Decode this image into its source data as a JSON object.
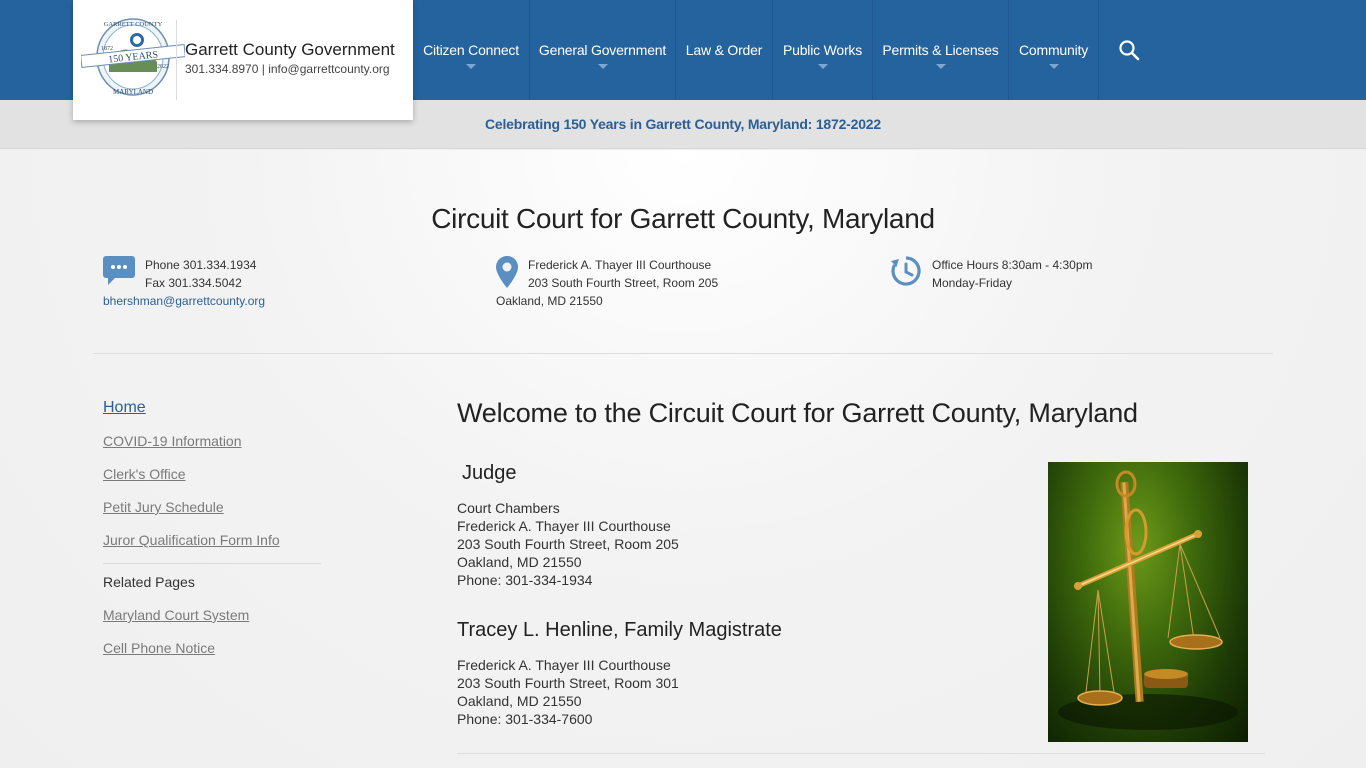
{
  "header": {
    "org_name": "Garrett County Government",
    "org_contact": "301.334.8970 | info@garrettcounty.org",
    "seal_text_top": "GARRETT COUNTY",
    "seal_text_years": "150 YEARS",
    "seal_year_left": "1872",
    "seal_year_right": "2022",
    "seal_text_bottom": "MARYLAND",
    "brand_color": "#25639f"
  },
  "nav": {
    "items": [
      {
        "label": "Citizen Connect",
        "has_dropdown": true
      },
      {
        "label": "General Government",
        "has_dropdown": true
      },
      {
        "label": "Law & Order",
        "has_dropdown": false
      },
      {
        "label": "Public Works",
        "has_dropdown": true
      },
      {
        "label": "Permits & Licenses",
        "has_dropdown": true
      },
      {
        "label": "Community",
        "has_dropdown": true
      }
    ],
    "search_icon": "search-icon"
  },
  "banner": {
    "text": "Celebrating 150 Years in Garrett County, Maryland: 1872-2022"
  },
  "court": {
    "title": "Circuit Court for Garrett County, Maryland",
    "contact": {
      "phone": "Phone 301.334.1934",
      "fax": "Fax 301.334.5042",
      "email": "bhershman@garrettcounty.org"
    },
    "location": {
      "building": "Frederick A. Thayer III Courthouse",
      "street": "203 South Fourth Street, Room 205",
      "city": "Oakland, MD 21550"
    },
    "hours": {
      "hours": "Office Hours 8:30am - 4:30pm",
      "days": "Monday-Friday"
    }
  },
  "sidebar": {
    "items": [
      {
        "label": "Home",
        "active": true
      },
      {
        "label": "COVID-19 Information"
      },
      {
        "label": "Clerk's Office"
      },
      {
        "label": "Petit Jury Schedule"
      },
      {
        "label": "Juror Qualification Form Info"
      }
    ],
    "related_heading": "Related Pages",
    "related": [
      {
        "label": "Maryland Court System"
      },
      {
        "label": "Cell Phone Notice"
      }
    ]
  },
  "main": {
    "title": "Welcome to the Circuit Court for Garrett County, Maryland",
    "judge": {
      "heading": "Judge",
      "lines": [
        "Court Chambers",
        "Frederick A. Thayer III Courthouse",
        "203 South Fourth Street, Room 205",
        "Oakland, MD 21550",
        "Phone: 301-334-1934"
      ]
    },
    "magistrate": {
      "heading": "Tracey L. Henline, Family Magistrate",
      "lines": [
        "Frederick A. Thayer III Courthouse",
        "203 South Fourth Street, Room 301",
        "Oakland, MD 21550",
        "Phone: 301-334-7600"
      ]
    }
  }
}
